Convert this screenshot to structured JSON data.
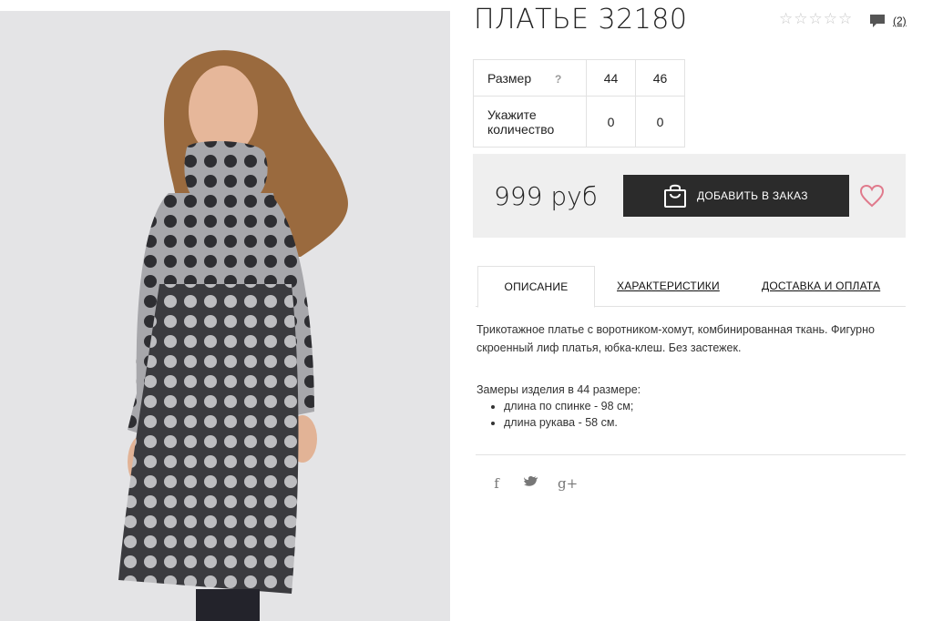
{
  "product": {
    "title": "ПЛАТЬЕ 32180",
    "rating_stars": 5,
    "reviews_count": "(2)"
  },
  "size_table": {
    "size_label": "Размер",
    "help_symbol": "?",
    "sizes": [
      "44",
      "46"
    ],
    "qty_label": "Укажите количество",
    "quantities": [
      "0",
      "0"
    ]
  },
  "price": {
    "value": "999 руб",
    "add_to_cart": "ДОБАВИТЬ В ЗАКАЗ"
  },
  "tabs": [
    {
      "label": "ОПИСАНИЕ",
      "active": true
    },
    {
      "label": "ХАРАКТЕРИСТИКИ",
      "active": false
    },
    {
      "label": "ДОСТАВКА И ОПЛАТА",
      "active": false
    }
  ],
  "description": {
    "text": "Трикотажное платье с воротником-хомут, комбинированная ткань. Фигурно скроенный лиф платья, юбка-клеш. Без застежек.",
    "measures_title": "Замеры изделия в 44 размере:",
    "measures": [
      "длина по спинке - 98 см;",
      "длина рукава - 58 см."
    ]
  },
  "social": {
    "facebook": "f",
    "twitter": "t",
    "google_plus": "g+"
  },
  "colors": {
    "button_bg": "#2b2b2b",
    "price_box_bg": "#efefef",
    "heart": "#e07a8c",
    "star_empty": "#c9c9c9"
  },
  "icons": [
    "star-icon",
    "comment-icon",
    "shopping-bag-icon",
    "heart-icon",
    "facebook-icon",
    "twitter-icon",
    "google-plus-icon"
  ]
}
